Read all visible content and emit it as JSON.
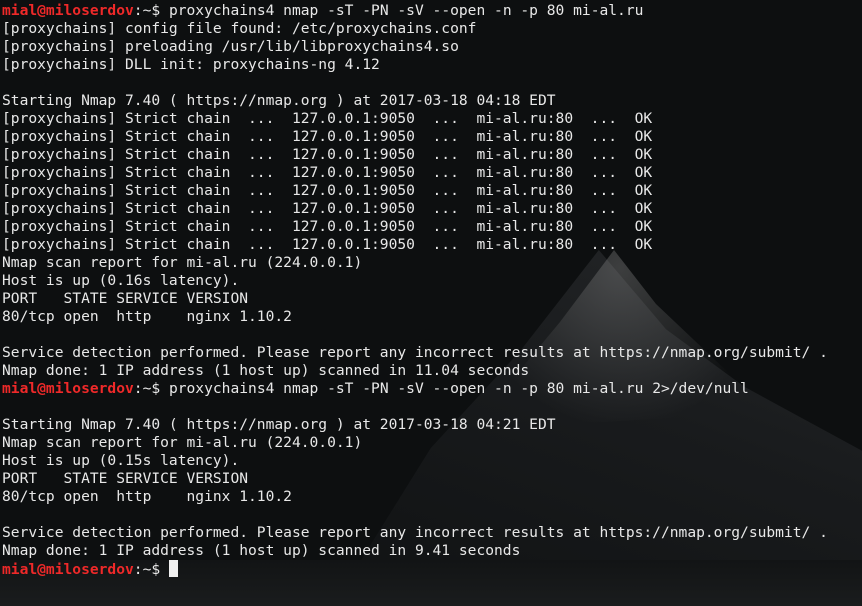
{
  "terminal": {
    "prompt_user": "mial@miloserdov",
    "prompt_suffix": ":~$ ",
    "lines": [
      {
        "kind": "prompt",
        "cmd": "proxychains4 nmap -sT -PN -sV --open -n -p 80 mi-al.ru"
      },
      {
        "kind": "out",
        "text": "[proxychains] config file found: /etc/proxychains.conf"
      },
      {
        "kind": "out",
        "text": "[proxychains] preloading /usr/lib/libproxychains4.so"
      },
      {
        "kind": "out",
        "text": "[proxychains] DLL init: proxychains-ng 4.12"
      },
      {
        "kind": "out",
        "text": ""
      },
      {
        "kind": "out",
        "text": "Starting Nmap 7.40 ( https://nmap.org ) at 2017-03-18 04:18 EDT"
      },
      {
        "kind": "out",
        "text": "[proxychains] Strict chain  ...  127.0.0.1:9050  ...  mi-al.ru:80  ...  OK"
      },
      {
        "kind": "out",
        "text": "[proxychains] Strict chain  ...  127.0.0.1:9050  ...  mi-al.ru:80  ...  OK"
      },
      {
        "kind": "out",
        "text": "[proxychains] Strict chain  ...  127.0.0.1:9050  ...  mi-al.ru:80  ...  OK"
      },
      {
        "kind": "out",
        "text": "[proxychains] Strict chain  ...  127.0.0.1:9050  ...  mi-al.ru:80  ...  OK"
      },
      {
        "kind": "out",
        "text": "[proxychains] Strict chain  ...  127.0.0.1:9050  ...  mi-al.ru:80  ...  OK"
      },
      {
        "kind": "out",
        "text": "[proxychains] Strict chain  ...  127.0.0.1:9050  ...  mi-al.ru:80  ...  OK"
      },
      {
        "kind": "out",
        "text": "[proxychains] Strict chain  ...  127.0.0.1:9050  ...  mi-al.ru:80  ...  OK"
      },
      {
        "kind": "out",
        "text": "[proxychains] Strict chain  ...  127.0.0.1:9050  ...  mi-al.ru:80  ...  OK"
      },
      {
        "kind": "out",
        "text": "Nmap scan report for mi-al.ru (224.0.0.1)"
      },
      {
        "kind": "out",
        "text": "Host is up (0.16s latency)."
      },
      {
        "kind": "out",
        "text": "PORT   STATE SERVICE VERSION"
      },
      {
        "kind": "out",
        "text": "80/tcp open  http    nginx 1.10.2"
      },
      {
        "kind": "out",
        "text": ""
      },
      {
        "kind": "out",
        "text": "Service detection performed. Please report any incorrect results at https://nmap.org/submit/ ."
      },
      {
        "kind": "out",
        "text": "Nmap done: 1 IP address (1 host up) scanned in 11.04 seconds"
      },
      {
        "kind": "prompt",
        "cmd": "proxychains4 nmap -sT -PN -sV --open -n -p 80 mi-al.ru 2>/dev/null"
      },
      {
        "kind": "out",
        "text": ""
      },
      {
        "kind": "out",
        "text": "Starting Nmap 7.40 ( https://nmap.org ) at 2017-03-18 04:21 EDT"
      },
      {
        "kind": "out",
        "text": "Nmap scan report for mi-al.ru (224.0.0.1)"
      },
      {
        "kind": "out",
        "text": "Host is up (0.15s latency)."
      },
      {
        "kind": "out",
        "text": "PORT   STATE SERVICE VERSION"
      },
      {
        "kind": "out",
        "text": "80/tcp open  http    nginx 1.10.2"
      },
      {
        "kind": "out",
        "text": ""
      },
      {
        "kind": "out",
        "text": "Service detection performed. Please report any incorrect results at https://nmap.org/submit/ ."
      },
      {
        "kind": "out",
        "text": "Nmap done: 1 IP address (1 host up) scanned in 9.41 seconds"
      },
      {
        "kind": "prompt",
        "cmd": "",
        "cursor": true
      }
    ]
  },
  "colors": {
    "prompt_user": "#ef2929",
    "text": "#e8e8e8",
    "background": "#0d0f10"
  }
}
